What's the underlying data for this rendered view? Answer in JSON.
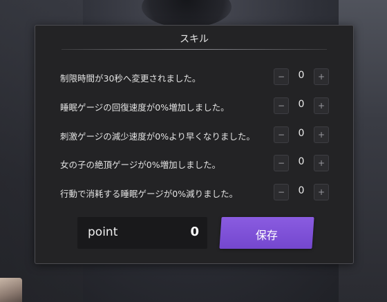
{
  "dialog": {
    "title": "スキル",
    "skills": [
      {
        "label": "制限時間が30秒へ変更されました。",
        "value": "0",
        "minus": "−",
        "plus": "+"
      },
      {
        "label": "睡眠ゲージの回復速度が0%増加しました。",
        "value": "0",
        "minus": "−",
        "plus": "+"
      },
      {
        "label": "刺激ゲージの減少速度が0%より早くなりました。",
        "value": "0",
        "minus": "−",
        "plus": "+"
      },
      {
        "label": "女の子の絶頂ゲージが0%増加しました。",
        "value": "0",
        "minus": "−",
        "plus": "+"
      },
      {
        "label": "行動で消耗する睡眠ゲージが0%減りました。",
        "value": "0",
        "minus": "−",
        "plus": "+"
      }
    ],
    "points": {
      "label": "point",
      "value": "0"
    },
    "save_label": "保存"
  },
  "colors": {
    "accent": "#7a4fd6",
    "panel": "#232325",
    "points_box": "#19191b"
  }
}
